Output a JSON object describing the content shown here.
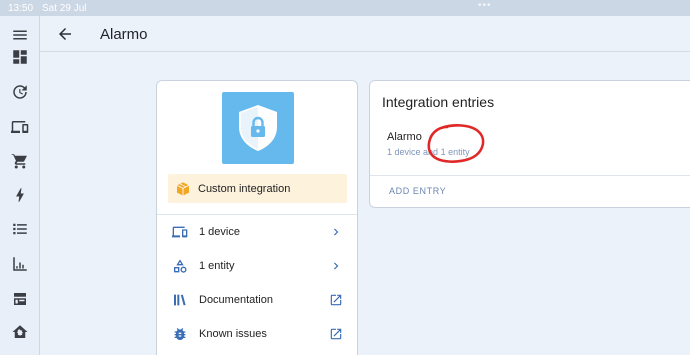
{
  "status_bar": {
    "time": "13:50",
    "date": "Sat 29 Jul",
    "dots": "•••"
  },
  "sidebar": {
    "icons": [
      "menu-icon",
      "dashboard-icon",
      "history-icon",
      "devices-icon",
      "cart-icon",
      "energy-icon",
      "list-icon",
      "chart-icon",
      "hacs-icon",
      "home-settings-icon"
    ]
  },
  "header": {
    "title": "Alarmo"
  },
  "integration_card": {
    "badge_label": "Custom integration",
    "rows": [
      {
        "label": "1 device",
        "icon": "devices-icon",
        "trail": "chevron-right-icon"
      },
      {
        "label": "1 entity",
        "icon": "shapes-icon",
        "trail": "chevron-right-icon"
      },
      {
        "label": "Documentation",
        "icon": "library-icon",
        "trail": "open-in-new-icon"
      },
      {
        "label": "Known issues",
        "icon": "bug-icon",
        "trail": "open-in-new-icon"
      }
    ]
  },
  "entries_card": {
    "title": "Integration entries",
    "entry": {
      "name": "Alarmo",
      "devices_link": "1 device",
      "and_text": "and",
      "entities_link": "1 entity"
    },
    "add_entry_label": "ADD ENTRY"
  },
  "colors": {
    "accent": "#3b6db5",
    "logo_bg": "#66b9ec",
    "badge_bg": "#fdf2dc",
    "annotation": "#e02828"
  }
}
